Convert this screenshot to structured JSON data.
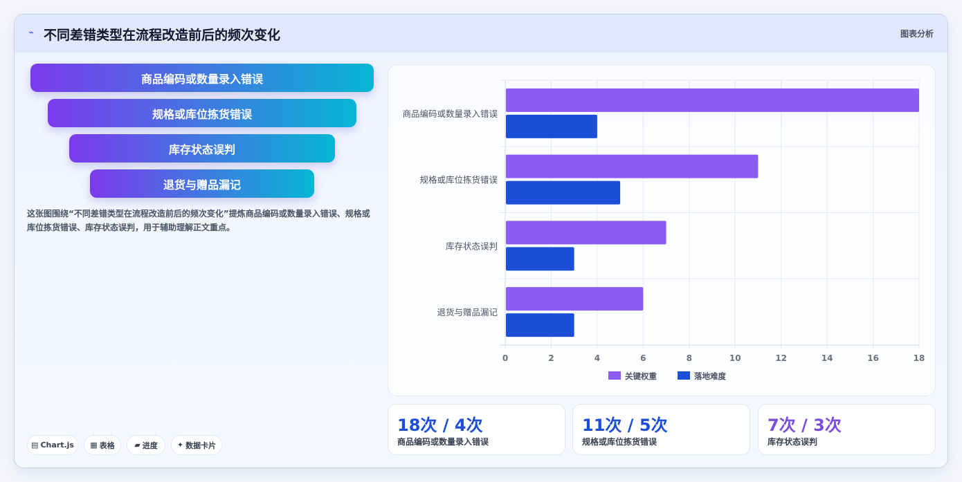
{
  "header": {
    "title": "不同差错类型在流程改造前后的频次变化",
    "tag": "图表分析"
  },
  "funnel": [
    "商品编码或数量录入错误",
    "规格或库位拣货错误",
    "库存状态误判",
    "退货与赠品漏记"
  ],
  "description": "这张图围绕“不同差错类型在流程改造前后的频次变化”提炼商品编码或数量录入错误、规格或库位拣货错误、库存状态误判，用于辅助理解正文重点。",
  "chips": [
    {
      "icon": "chart-icon",
      "label": "Chart.js"
    },
    {
      "icon": "table-icon",
      "label": "表格"
    },
    {
      "icon": "progress-icon",
      "label": "进度"
    },
    {
      "icon": "card-icon",
      "label": "数据卡片"
    }
  ],
  "stats": [
    {
      "value": "18次 / 4次",
      "label": "商品编码或数量录入错误",
      "color": "#1d4ed8"
    },
    {
      "value": "11次 / 5次",
      "label": "规格或库位拣货错误",
      "color": "#1d4ed8"
    },
    {
      "value": "7次 / 3次",
      "label": "库存状态误判",
      "color": "#7c4ddb"
    }
  ],
  "chart_data": {
    "type": "bar",
    "orientation": "horizontal",
    "categories": [
      "商品编码或数量录入错误",
      "规格或库位拣货错误",
      "库存状态误判",
      "退货与赠品漏记"
    ],
    "series": [
      {
        "name": "关键权重",
        "values": [
          18,
          11,
          7,
          6
        ],
        "color": "#8b5cf6"
      },
      {
        "name": "落地难度",
        "values": [
          4,
          5,
          3,
          3
        ],
        "color": "#1d4ed8"
      }
    ],
    "xlim": [
      0,
      18
    ],
    "xticks": [
      0,
      2,
      4,
      6,
      8,
      10,
      12,
      14,
      16,
      18
    ],
    "grid": true,
    "legend": "bottom"
  }
}
